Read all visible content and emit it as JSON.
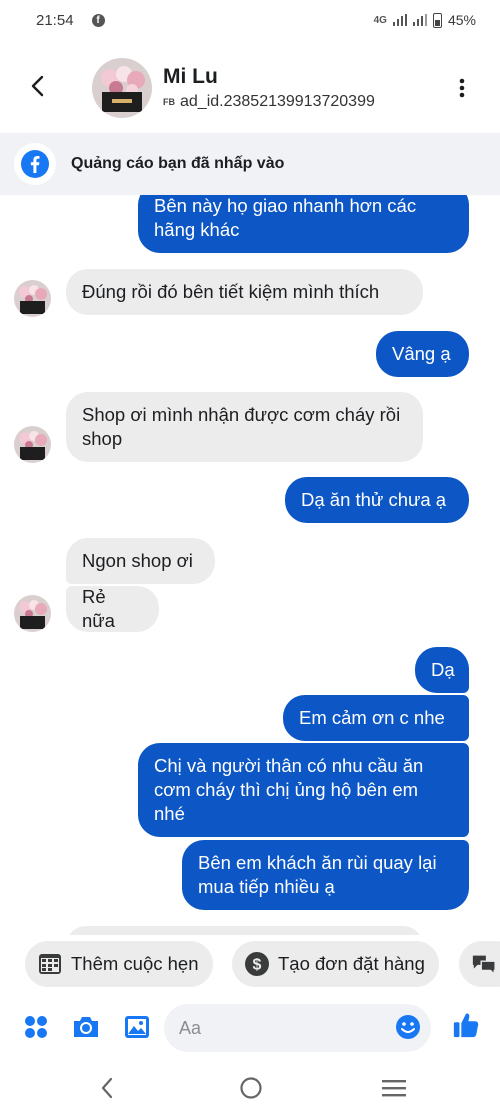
{
  "status_bar": {
    "time": "21:54",
    "network": "4G",
    "battery": "45%"
  },
  "header": {
    "contact_name": "Mi Lu",
    "source_tag": "FB",
    "contact_id": "ad_id.23852139913720399"
  },
  "ad_banner": {
    "text": "Quảng cáo bạn đã nhấp vào"
  },
  "messages": [
    {
      "side": "out",
      "text": "Bên này họ giao nhanh hơn các hãng khác"
    },
    {
      "side": "in",
      "text": "Đúng rồi đó bên tiết kiệm mình thích"
    },
    {
      "side": "out",
      "text": "Vâng ạ"
    },
    {
      "side": "in",
      "text": "Shop ơi mình nhận được cơm cháy rồi shop"
    },
    {
      "side": "out",
      "text": "Dạ ăn thử chưa ạ"
    },
    {
      "side": "in",
      "text": "Ngon shop ơi"
    },
    {
      "side": "in",
      "text": "Rẻ nữa"
    },
    {
      "side": "out",
      "text": "Dạ"
    },
    {
      "side": "out",
      "text": "Em cảm ơn c nhe"
    },
    {
      "side": "out",
      "text": "Chị và người thân có nhu cầu ăn cơm cháy thì chị ủng hộ bên em nhé"
    },
    {
      "side": "out",
      "text": "Bên em khách ăn rùi quay lại mua tiếp nhiều ạ"
    }
  ],
  "quick_actions": [
    {
      "label": "Thêm cuộc hẹn",
      "icon": "calendar-icon"
    },
    {
      "label": "Tạo đơn đặt hàng",
      "icon": "dollar-icon"
    },
    {
      "label": "",
      "icon": "chat-bubbles-icon"
    }
  ],
  "composer": {
    "placeholder": "Aa",
    "icons": [
      "apps-icon",
      "camera-icon",
      "gallery-icon",
      "emoji-icon",
      "thumbs-up-icon"
    ]
  },
  "nav_bar": {
    "icons": [
      "back-nav-icon",
      "home-nav-icon",
      "recents-nav-icon"
    ]
  },
  "colors": {
    "accent": "#0c56c6",
    "brand": "#1877f2",
    "incoming_bubble": "#ececec",
    "banner_bg": "#f0f2f5"
  }
}
